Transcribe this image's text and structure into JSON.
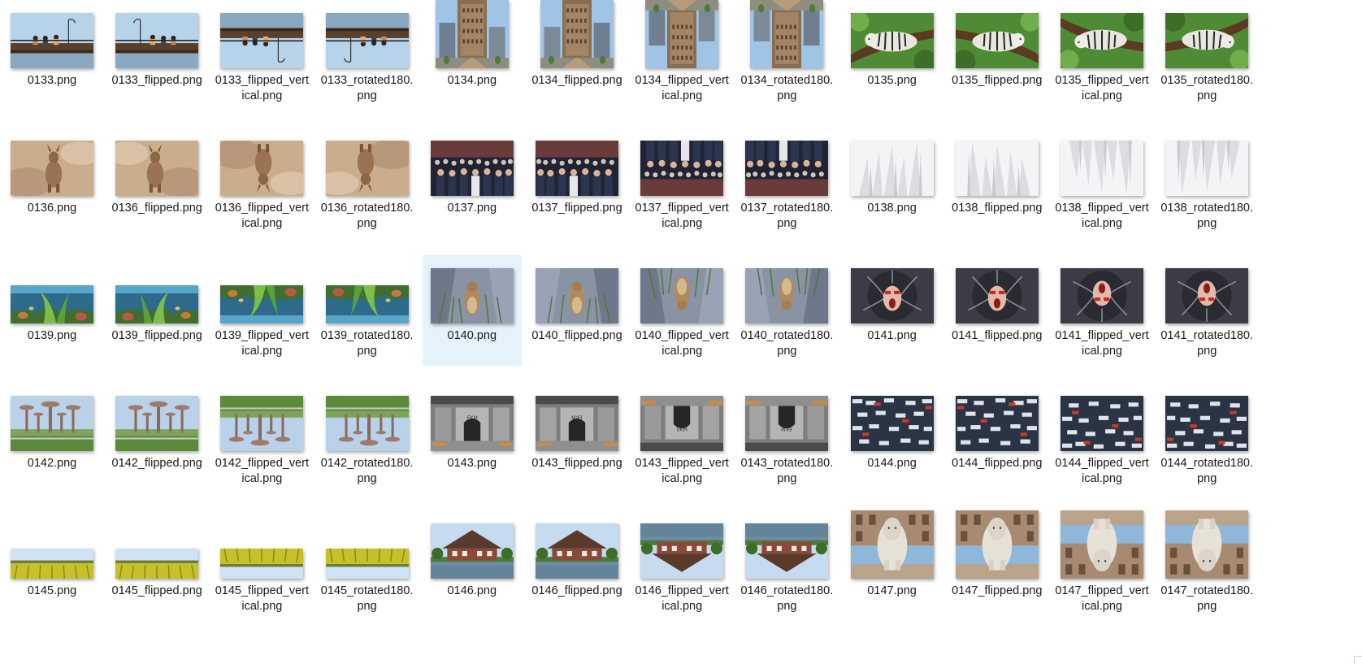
{
  "selected_file": "0140.png",
  "variants": [
    "",
    "_flipped",
    "_flipped_vertical",
    "_rotated180"
  ],
  "images": [
    {
      "id": "0133",
      "scene": "pier",
      "shape": "std"
    },
    {
      "id": "0134",
      "scene": "building",
      "shape": "tall"
    },
    {
      "id": "0135",
      "scene": "tiger",
      "shape": "std"
    },
    {
      "id": "0136",
      "scene": "kangaroo",
      "shape": "std"
    },
    {
      "id": "0137",
      "scene": "crowd",
      "shape": "std"
    },
    {
      "id": "0138",
      "scene": "abstract",
      "shape": "std"
    },
    {
      "id": "0139",
      "scene": "reef",
      "shape": "wide"
    },
    {
      "id": "0140",
      "scene": "groundhog",
      "shape": "std"
    },
    {
      "id": "0141",
      "scene": "face",
      "shape": "std"
    },
    {
      "id": "0142",
      "scene": "garden",
      "shape": "std"
    },
    {
      "id": "0143",
      "scene": "concrete",
      "shape": "std"
    },
    {
      "id": "0144",
      "scene": "cars",
      "shape": "std"
    },
    {
      "id": "0145",
      "scene": "field",
      "shape": "panorama"
    },
    {
      "id": "0146",
      "scene": "house",
      "shape": "std"
    },
    {
      "id": "0147",
      "scene": "lion",
      "shape": "tallish"
    }
  ],
  "files": [
    {
      "name": "0133.png"
    },
    {
      "name": "0133_flipped.png"
    },
    {
      "name": "0133_flipped_vertical.png"
    },
    {
      "name": "0133_rotated180.png"
    },
    {
      "name": "0134.png"
    },
    {
      "name": "0134_flipped.png"
    },
    {
      "name": "0134_flipped_vertical.png"
    },
    {
      "name": "0134_rotated180.png"
    },
    {
      "name": "0135.png"
    },
    {
      "name": "0135_flipped.png"
    },
    {
      "name": "0135_flipped_vertical.png"
    },
    {
      "name": "0135_rotated180.png"
    },
    {
      "name": "0136.png"
    },
    {
      "name": "0136_flipped.png"
    },
    {
      "name": "0136_flipped_vertical.png"
    },
    {
      "name": "0136_rotated180.png"
    },
    {
      "name": "0137.png"
    },
    {
      "name": "0137_flipped.png"
    },
    {
      "name": "0137_flipped_vertical.png"
    },
    {
      "name": "0137_rotated180.png"
    },
    {
      "name": "0138.png"
    },
    {
      "name": "0138_flipped.png"
    },
    {
      "name": "0138_flipped_vertical.png"
    },
    {
      "name": "0138_rotated180.png"
    },
    {
      "name": "0139.png"
    },
    {
      "name": "0139_flipped.png"
    },
    {
      "name": "0139_flipped_vertical.png"
    },
    {
      "name": "0139_rotated180.png"
    },
    {
      "name": "0140.png"
    },
    {
      "name": "0140_flipped.png"
    },
    {
      "name": "0140_flipped_vertical.png"
    },
    {
      "name": "0140_rotated180.png"
    },
    {
      "name": "0141.png"
    },
    {
      "name": "0141_flipped.png"
    },
    {
      "name": "0141_flipped_vertical.png"
    },
    {
      "name": "0141_rotated180.png"
    },
    {
      "name": "0142.png"
    },
    {
      "name": "0142_flipped.png"
    },
    {
      "name": "0142_flipped_vertical.png"
    },
    {
      "name": "0142_rotated180.png"
    },
    {
      "name": "0143.png"
    },
    {
      "name": "0143_flipped.png"
    },
    {
      "name": "0143_flipped_vertical.png"
    },
    {
      "name": "0143_rotated180.png"
    },
    {
      "name": "0144.png"
    },
    {
      "name": "0144_flipped.png"
    },
    {
      "name": "0144_flipped_vertical.png"
    },
    {
      "name": "0144_rotated180.png"
    },
    {
      "name": "0145.png"
    },
    {
      "name": "0145_flipped.png"
    },
    {
      "name": "0145_flipped_vertical.png"
    },
    {
      "name": "0145_rotated180.png"
    },
    {
      "name": "0146.png"
    },
    {
      "name": "0146_flipped.png"
    },
    {
      "name": "0146_flipped_vertical.png"
    },
    {
      "name": "0146_rotated180.png"
    },
    {
      "name": "0147.png"
    },
    {
      "name": "0147_flipped.png"
    },
    {
      "name": "0147_flipped_vertical.png"
    },
    {
      "name": "0147_rotated180.png"
    }
  ],
  "colors": {
    "selection_bg": "#e5f1fb",
    "label_text": "#1a1a1a",
    "background": "#ffffff"
  }
}
